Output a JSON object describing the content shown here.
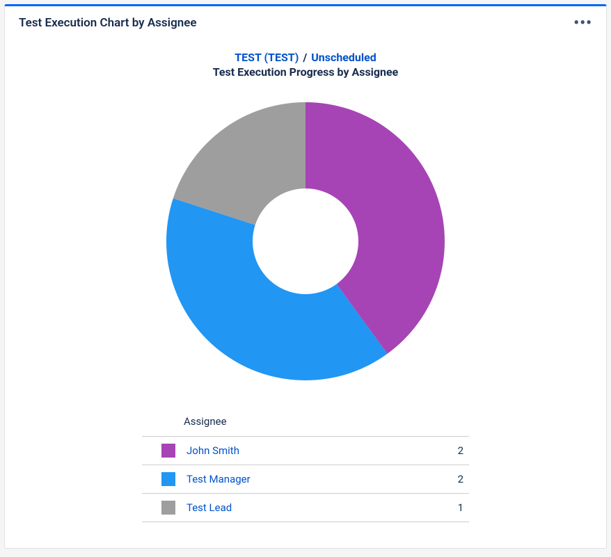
{
  "header": {
    "title": "Test Execution Chart by Assignee"
  },
  "breadcrumb": {
    "project": "TEST (TEST)",
    "separator": "/",
    "cycle": "Unscheduled"
  },
  "subtitle": "Test Execution Progress by Assignee",
  "legend": {
    "column_label": "Assignee",
    "rows": [
      {
        "name": "John Smith",
        "value": 2,
        "color": "#A644B5"
      },
      {
        "name": "Test Manager",
        "value": 2,
        "color": "#2196F3"
      },
      {
        "name": "Test Lead",
        "value": 1,
        "color": "#9E9E9E"
      }
    ]
  },
  "chart_data": {
    "type": "pie",
    "title": "Test Execution Progress by Assignee",
    "categories": [
      "John Smith",
      "Test Manager",
      "Test Lead"
    ],
    "values": [
      2,
      2,
      1
    ],
    "colors": [
      "#A644B5",
      "#2196F3",
      "#9E9E9E"
    ],
    "donut_inner_ratio": 0.38
  }
}
